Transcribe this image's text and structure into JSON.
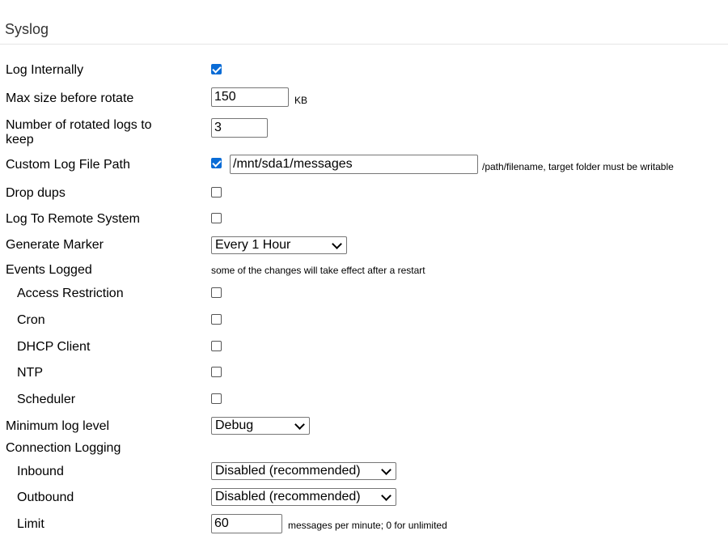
{
  "section_title": "Syslog",
  "fields": {
    "log_internally": {
      "label": "Log Internally",
      "checked": true
    },
    "max_size": {
      "label": "Max size before rotate",
      "value": "150",
      "unit": "KB"
    },
    "rotated_logs": {
      "label": "Number of rotated logs to keep",
      "value": "3"
    },
    "custom_path": {
      "label": "Custom Log File Path",
      "checked": true,
      "value": "/mnt/sda1/messages",
      "hint": "/path/filename, target folder must be writable"
    },
    "drop_dups": {
      "label": "Drop dups",
      "checked": false
    },
    "remote_system": {
      "label": "Log To Remote System",
      "checked": false
    },
    "generate_marker": {
      "label": "Generate Marker",
      "selected": "Every 1 Hour"
    },
    "events_logged": {
      "label": "Events Logged",
      "note": "some of the changes will take effect after a restart"
    },
    "access_restriction": {
      "label": "Access Restriction",
      "checked": false
    },
    "cron": {
      "label": "Cron",
      "checked": false
    },
    "dhcp_client": {
      "label": "DHCP Client",
      "checked": false
    },
    "ntp": {
      "label": "NTP",
      "checked": false
    },
    "scheduler": {
      "label": "Scheduler",
      "checked": false
    },
    "min_level": {
      "label": "Minimum log level",
      "selected": "Debug"
    },
    "connection_logging": {
      "label": "Connection Logging"
    },
    "inbound": {
      "label": "Inbound",
      "selected": "Disabled (recommended)"
    },
    "outbound": {
      "label": "Outbound",
      "selected": "Disabled (recommended)"
    },
    "limit": {
      "label": "Limit",
      "value": "60",
      "hint": "messages per minute; 0 for unlimited"
    }
  }
}
